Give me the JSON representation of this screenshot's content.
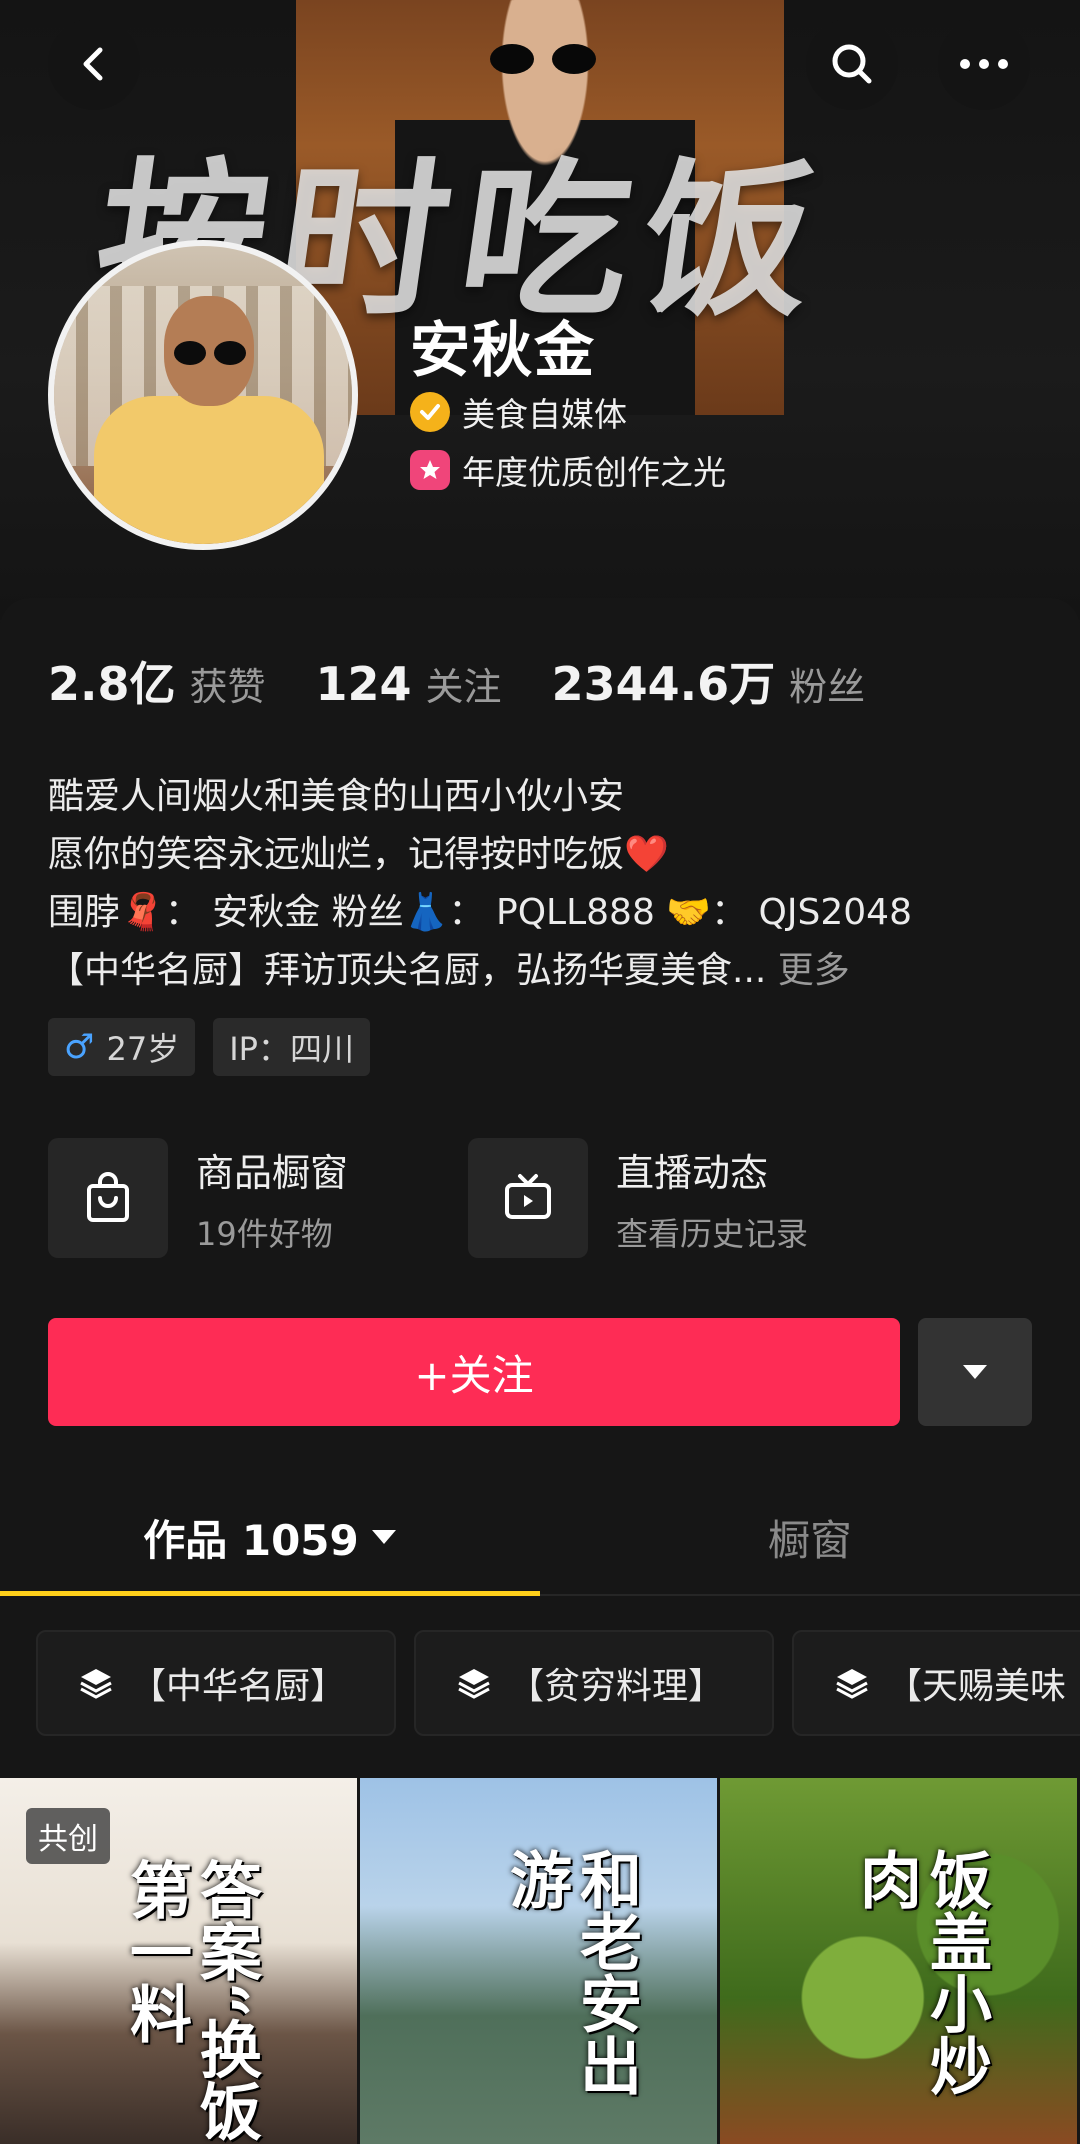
{
  "banner": {
    "title": "按时吃饭"
  },
  "profile": {
    "name": "安秋金",
    "badges": [
      {
        "label": "美食自媒体",
        "icon": "verified-check-icon",
        "color": "#f5b21a"
      },
      {
        "label": "年度优质创作之光",
        "icon": "star-badge-icon",
        "color": "#f0457a"
      }
    ]
  },
  "stats": [
    {
      "value": "2.8亿",
      "label": "获赞"
    },
    {
      "value": "124",
      "label": "关注"
    },
    {
      "value": "2344.6万",
      "label": "粉丝"
    }
  ],
  "bio": {
    "line1": "酷爱人间烟火和美食的山西小伙小安",
    "line2": "愿你的笑容永远灿烂，记得按时吃饭❤️",
    "line3": "围脖🧣：  安秋金 粉丝👗：  PQLL888 🤝：  QJS2048",
    "line4": "【中华名厨】拜访顶尖名厨，弘扬华夏美食...",
    "more": "更多"
  },
  "chips": {
    "gender_age": "27岁",
    "gender_symbol": "♂",
    "ip": "IP：四川"
  },
  "services": [
    {
      "title": "商品橱窗",
      "subtitle": "19件好物",
      "icon": "shopping-bag-icon"
    },
    {
      "title": "直播动态",
      "subtitle": "查看历史记录",
      "icon": "tv-icon"
    }
  ],
  "actions": {
    "follow": "+关注"
  },
  "tabs": {
    "works": "作品 1059",
    "showcase": "橱窗"
  },
  "collections": [
    "【中华名厨】",
    "【贫穷料理】",
    "【天赐美味"
  ],
  "videos": [
    {
      "tag": "共创",
      "cover_text": "答案“换饭第一料"
    },
    {
      "tag": "",
      "cover_text": "和老安出游"
    },
    {
      "tag": "",
      "cover_text": "饭盖小炒肉"
    }
  ],
  "colors": {
    "accent": "#fe2c55",
    "tab_indicator": "#ffcf1a"
  }
}
